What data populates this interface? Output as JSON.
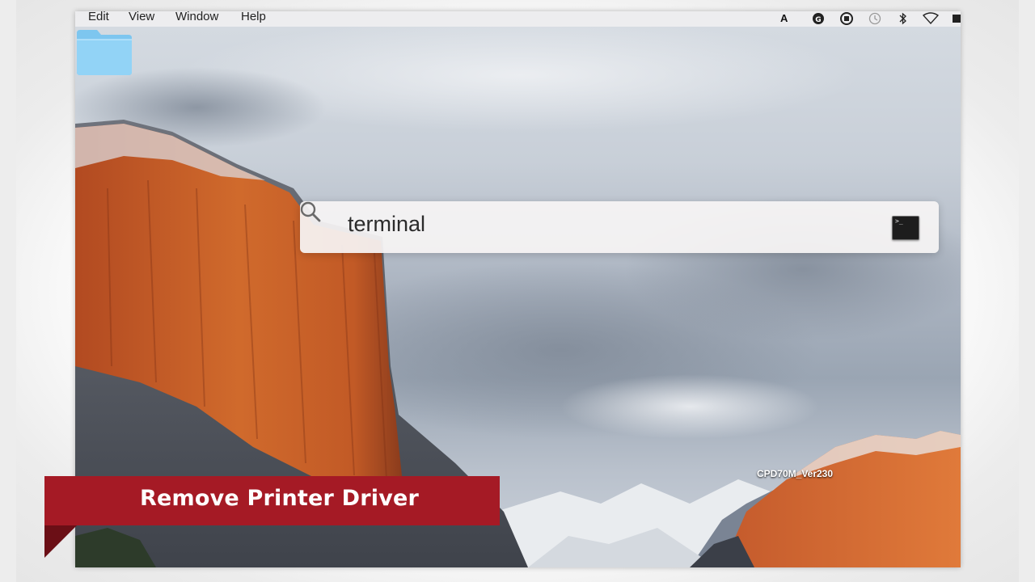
{
  "menubar": {
    "items": [
      "Edit",
      "View",
      "Window",
      "Help"
    ]
  },
  "status_icons": [
    "adobe-icon",
    "grammarly-icon",
    "record-icon",
    "time-machine-icon",
    "bluetooth-icon",
    "wifi-icon",
    "battery-icon"
  ],
  "spotlight": {
    "query": "terminal",
    "result_app": "Terminal"
  },
  "desktop": {
    "folder_label": "CPD70M_Ver230"
  },
  "banner": {
    "text": "Remove Printer Driver",
    "color": "#a51a25"
  }
}
